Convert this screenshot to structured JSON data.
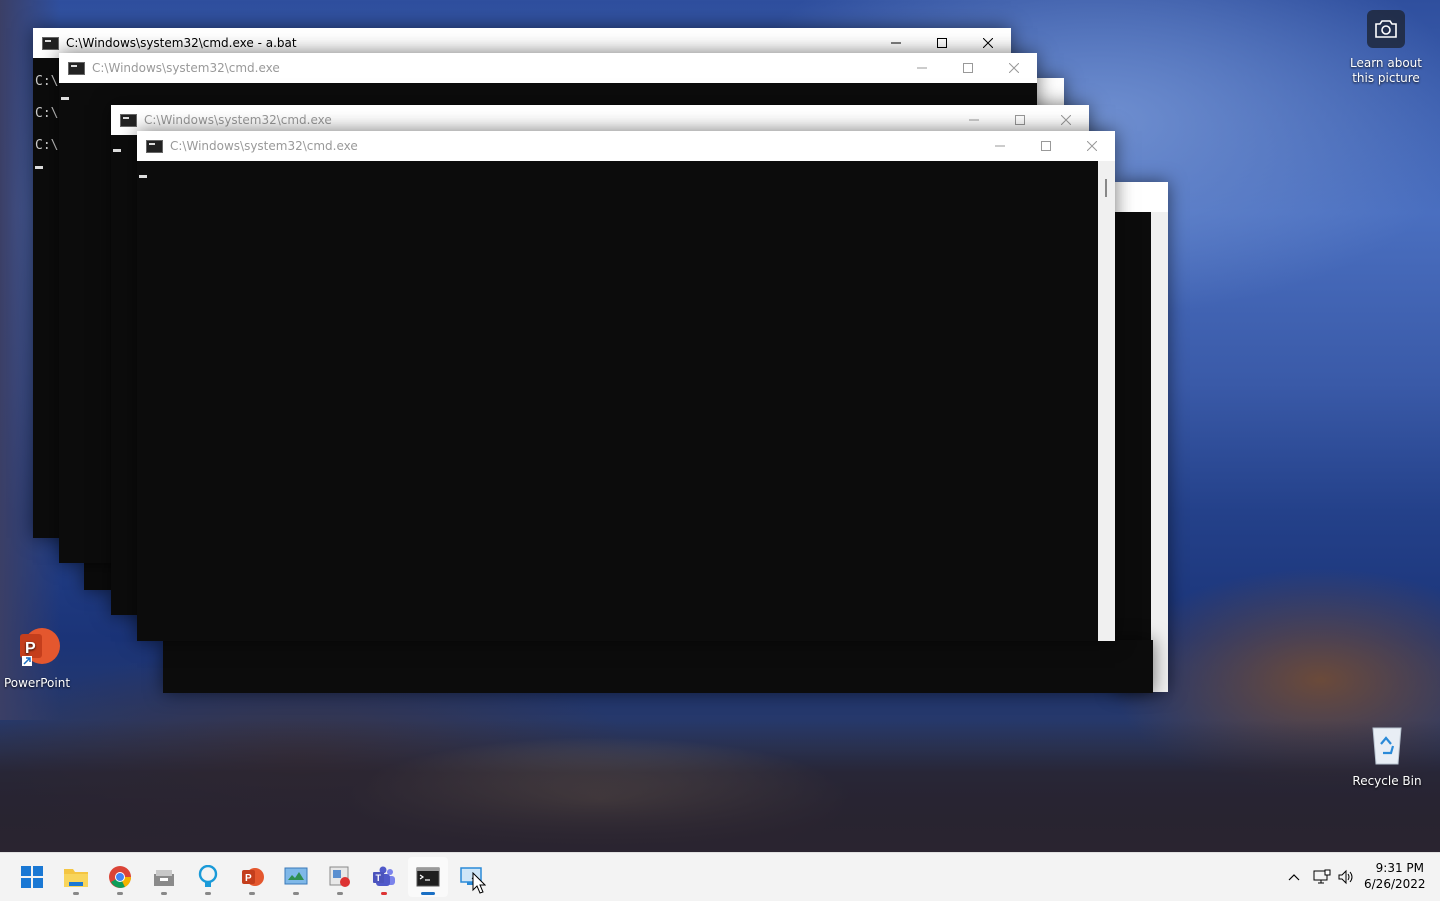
{
  "desktop": {
    "icons": {
      "learn_about": "Learn about this picture",
      "powerpoint": "PowerPoint",
      "recycle_bin": "Recycle Bin"
    }
  },
  "windows": [
    {
      "title": "C:\\Windows\\system32\\cmd.exe - a.bat",
      "lines": [
        "C:\\",
        "C:\\",
        "C:\\"
      ]
    },
    {
      "title": "C:\\Windows\\system32\\cmd.exe"
    },
    {
      "title": "C:\\Windows\\system32\\cmd.exe"
    },
    {
      "title": "C:\\Windows\\system32\\cmd.exe"
    }
  ],
  "taskbar": {
    "apps": [
      "start-icon",
      "file-explorer-icon",
      "chrome-icon",
      "app-icon",
      "bulb-icon",
      "powerpoint-icon",
      "control-panel-icon",
      "media-icon",
      "teams-icon",
      "terminal-icon",
      "remote-desktop-icon"
    ],
    "clock": {
      "time": "9:31 PM",
      "date": "6/26/2022"
    }
  },
  "colors": {
    "accent": "#1a6fc4",
    "console_bg": "#0c0c0c",
    "taskbar_bg": "#f3f3f3"
  }
}
